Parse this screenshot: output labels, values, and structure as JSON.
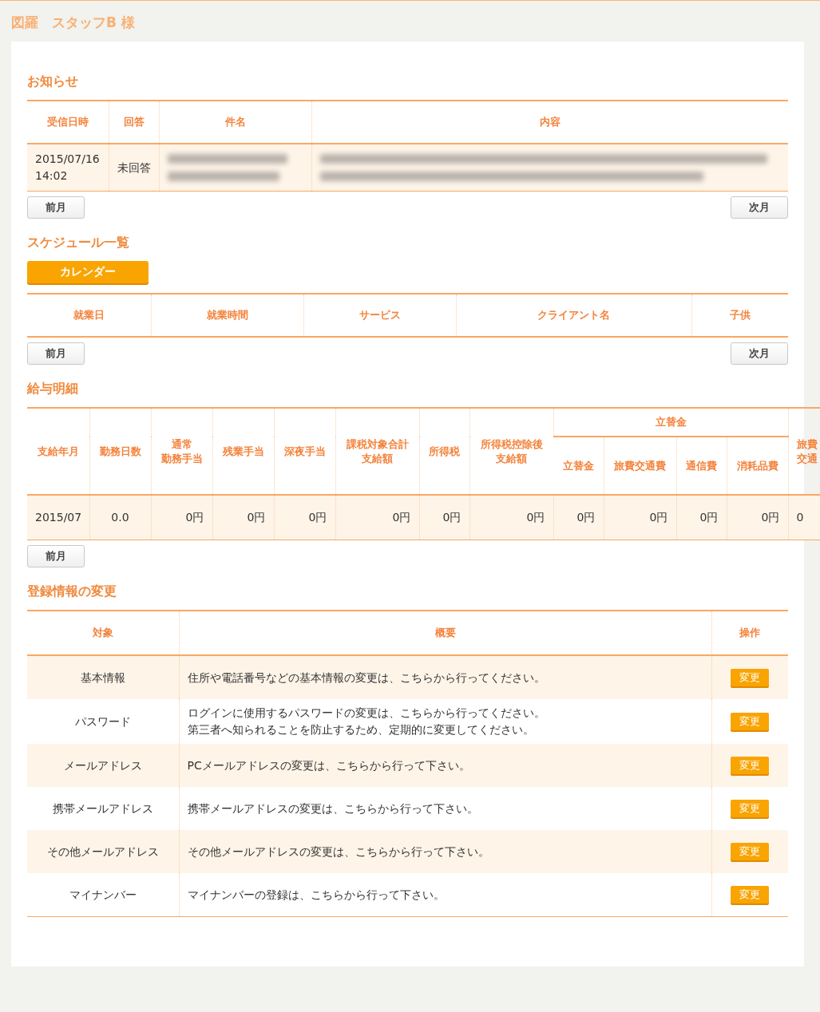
{
  "header": {
    "title": "図羅　スタッフB 様"
  },
  "notices": {
    "heading": "お知らせ",
    "columns": [
      "受信日時",
      "回答",
      "件名",
      "内容"
    ],
    "rows": [
      {
        "received": "2015/07/16\n14:02",
        "answer": "未回答"
      }
    ],
    "prev_button": "前月",
    "next_button": "次月"
  },
  "schedule": {
    "heading": "スケジュール一覧",
    "calendar_button": "カレンダー",
    "columns": [
      "就業日",
      "就業時間",
      "サービス",
      "クライアント名",
      "子供"
    ],
    "prev_button": "前月",
    "next_button": "次月"
  },
  "payroll": {
    "heading": "給与明細",
    "columns": [
      {
        "lines": [
          "支給年月"
        ]
      },
      {
        "lines": [
          "勤務日数"
        ]
      },
      {
        "lines": [
          "通常",
          "勤務手当"
        ]
      },
      {
        "lines": [
          "残業手当"
        ]
      },
      {
        "lines": [
          "深夜手当"
        ]
      },
      {
        "lines": [
          "課税対象合計",
          "支給額"
        ]
      },
      {
        "lines": [
          "所得税"
        ]
      },
      {
        "lines": [
          "所得税控除後",
          "支給額"
        ]
      }
    ],
    "group": {
      "label": "立替金",
      "columns": [
        "立替金",
        "旅費交通費",
        "通信費",
        "消耗品費"
      ]
    },
    "column_13": {
      "lines": [
        "旅費",
        "交通"
      ]
    },
    "rows": [
      {
        "cells": [
          "2015/07",
          "0.0",
          "0円",
          "0円",
          "0円",
          "0円",
          "0円",
          "0円",
          "0円",
          "0円",
          "0円",
          "0円",
          "0"
        ]
      }
    ],
    "prev_button": "前月"
  },
  "registration": {
    "heading": "登録情報の変更",
    "columns": [
      "対象",
      "概要",
      "操作"
    ],
    "rows": [
      {
        "target": "基本情報",
        "summary": [
          "住所や電話番号などの基本情報の変更は、こちらから行ってください。"
        ],
        "button": "変更"
      },
      {
        "target": "パスワード",
        "summary": [
          "ログインに使用するパスワードの変更は、こちらから行ってください。",
          "第三者へ知られることを防止するため、定期的に変更してください。"
        ],
        "button": "変更"
      },
      {
        "target": "メールアドレス",
        "summary": [
          "PCメールアドレスの変更は、こちらから行って下さい。"
        ],
        "button": "変更"
      },
      {
        "target": "携帯メールアドレス",
        "summary": [
          "携帯メールアドレスの変更は、こちらから行って下さい。"
        ],
        "button": "変更"
      },
      {
        "target": "その他メールアドレス",
        "summary": [
          "その他メールアドレスの変更は、こちらから行って下さい。"
        ],
        "button": "変更"
      },
      {
        "target": "マイナンバー",
        "summary": [
          "マイナンバーの登録は、こちらから行って下さい。"
        ],
        "button": "変更"
      }
    ]
  }
}
